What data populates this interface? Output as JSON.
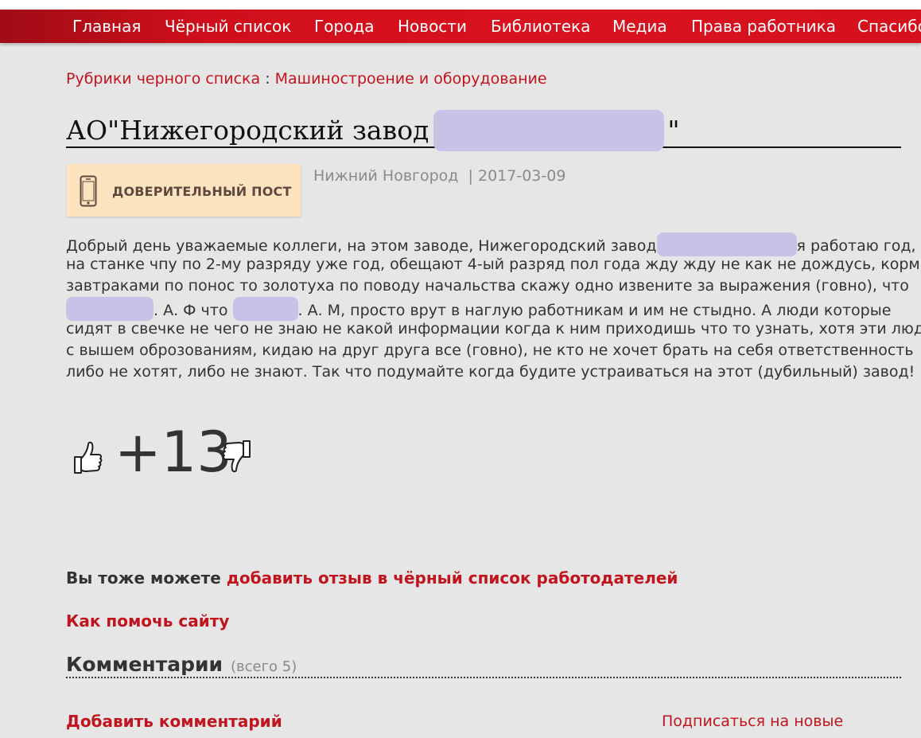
{
  "nav": {
    "items": [
      {
        "label": "Главная"
      },
      {
        "label": "Чёрный список"
      },
      {
        "label": "Города"
      },
      {
        "label": "Новости"
      },
      {
        "label": "Библиотека"
      },
      {
        "label": "Медиа"
      },
      {
        "label": "Права работника"
      },
      {
        "label": "Спасибо"
      }
    ]
  },
  "breadcrumb": {
    "root": "Рубрики черного списка",
    "separator": " : ",
    "category": "Машиностроение и оборудование"
  },
  "post": {
    "title_prefix": "АО\"Нижегородский завод",
    "title_suffix": "\"",
    "badge": "ДОВЕРИТЕЛЬНЫЙ ПОСТ",
    "city": "Нижний Новгород",
    "date_separator": "  | ",
    "date": "2017-03-09",
    "body": {
      "l1a": "Добрый день уважаемые коллеги, на этом заводе, Нижегородский завод",
      "l1b": "я работаю год,",
      "l2": "на станке чпу по 2-му разряду уже год, обещают 4-ый разряд пол года жду жду не как не дождусь, кормят",
      "l3": "завтраками по понос то золотуха по поводу начальства скажу одно извените за выражения (говно), что",
      "l4a": ". А. Ф что",
      "l4b": ". А. М, просто врут в наглую работникам и им не стыдно. А люди которые",
      "l5": "сидят в свечке не чего не знаю не какой информации когда к ним приходишь что то узнать, хотя эти люди",
      "l6": "с вышем оброзованиям, кидаю на друг друга все (говно), не кто не хочет брать на себя ответственность",
      "l7": "либо не хотят, либо не знают. Так что подумайте когда будите устраиваться на этот (дубильный) завод!"
    },
    "rating": "+13"
  },
  "footer": {
    "cta_prefix": "Вы тоже можете ",
    "cta_link": "добавить отзыв в чёрный список работодателей",
    "help_link": "Как помочь сайту",
    "comments_title": "Комментарии",
    "comments_count": "(всего 5)",
    "add_comment": "Добавить комментарий",
    "subscribe": "Подписаться на новые"
  },
  "colors": {
    "nav_red": "#d9121f",
    "link_red": "#c0141e",
    "redaction": "#c7c2e6",
    "badge_bg": "#fde3c0",
    "page_bg": "#e6e6e6"
  },
  "icons": [
    "phone-icon",
    "thumbs-up-icon",
    "thumbs-down-icon"
  ]
}
